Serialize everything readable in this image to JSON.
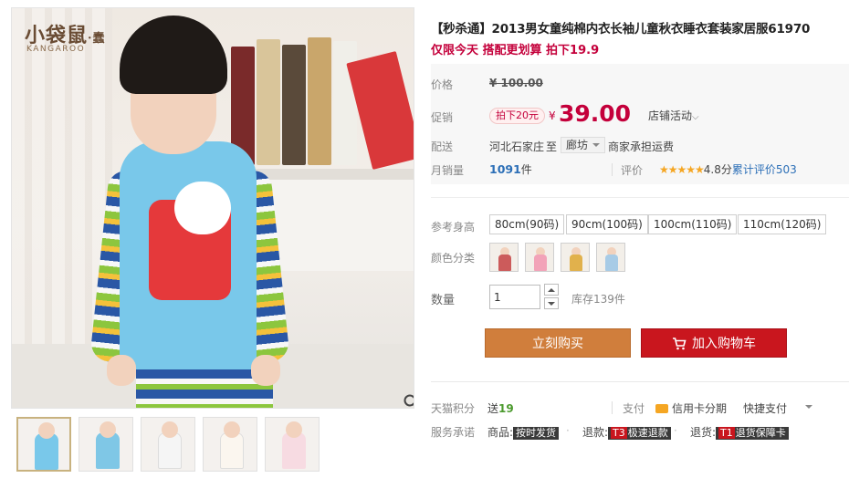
{
  "brand": {
    "name": "小袋鼠",
    "suffix": "·蠢",
    "sub": "KANGAROO"
  },
  "gallery": {
    "thumb_colors": [
      "#79c8ea",
      "#7fc7e6",
      "#f5f5f5",
      "#fbf6ef",
      "#f7dbe2"
    ],
    "zoom_icon": "magnifier-icon"
  },
  "product": {
    "title": "【秒杀通】2013男女童纯棉内衣长袖儿童秋衣睡衣套装家居服61970",
    "subtitle": "仅限今天 搭配更划算 拍下19.9"
  },
  "price": {
    "label": "价格",
    "original": "¥ 100.00"
  },
  "promo": {
    "label": "促销",
    "badge": "拍下20元",
    "currency": "¥",
    "sale_price": "39.00",
    "shop_activity": "店铺活动",
    "shop_activity_caret": "⌵"
  },
  "shipping": {
    "label": "配送",
    "origin": "河北石家庄",
    "to": "至",
    "destination": "廊坊",
    "fee": "商家承担运费"
  },
  "sales": {
    "label": "月销量",
    "count": "1091",
    "unit": "件",
    "review_label": "评价",
    "stars": "★★★★★",
    "rating": "4.8分",
    "total_reviews": "累计评价503"
  },
  "sku": {
    "size_label": "参考身高",
    "sizes": [
      "80cm(90码)",
      "90cm(100码)",
      "100cm(110码)",
      "110cm(120码)"
    ],
    "color_label": "颜色分类",
    "color_swatches": [
      "#cc5b5b",
      "#f2a3b8",
      "#e1b14c",
      "#a7cbe6"
    ]
  },
  "quantity": {
    "label": "数量",
    "value": "1",
    "stock": "库存139件"
  },
  "actions": {
    "buy_now": "立刻购买",
    "add_cart": "加入购物车"
  },
  "points": {
    "label": "天猫积分",
    "prefix": "送",
    "value": "19"
  },
  "payment": {
    "label": "支付",
    "credit": "信用卡分期",
    "quick": "快捷支付"
  },
  "service": {
    "label": "服务承诺",
    "goods_label": "商品:",
    "goods_tag": "按时发货",
    "refund_label": "退款:",
    "refund_prefix": "T3",
    "refund_tag": "极速退款",
    "return_label": "退货:",
    "return_prefix": "T1",
    "return_tag": "退货保障卡",
    "dot": "·"
  }
}
